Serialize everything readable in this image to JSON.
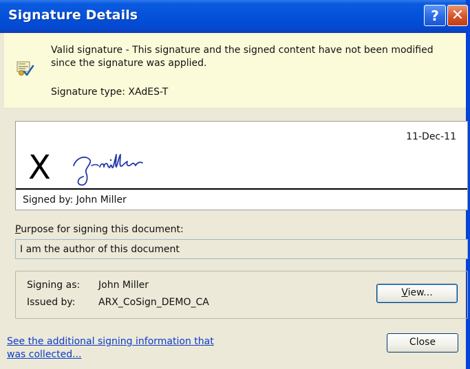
{
  "window": {
    "title": "Signature Details",
    "help_button": "?",
    "close_button": "✕"
  },
  "info": {
    "message": "Valid signature - This signature and the signed content have not been modified since the signature was applied.",
    "signature_type": "Signature type: XAdES-T"
  },
  "signature": {
    "date": "11-Dec-11",
    "x_mark": "X",
    "signed_by": "Signed by: John Miller"
  },
  "purpose": {
    "label_underlined": "P",
    "label_rest": "urpose for signing this document:",
    "value": "I am the author of this document"
  },
  "signer": {
    "signing_as_label": "Signing as:",
    "signing_as_value": "John Miller",
    "issued_by_label": "Issued by:",
    "issued_by_value": "ARX_CoSign_DEMO_CA"
  },
  "buttons": {
    "view_underlined": "V",
    "view_rest": "iew...",
    "close": "Close"
  },
  "link": {
    "text": "See the additional signing information that was collected..."
  },
  "colors": {
    "titlebar": "#0450d8",
    "info_background": "#fbfbd9",
    "dialog_background": "#ece9d8",
    "link": "#0a3cc8"
  },
  "icons": {
    "info": "certificate-check-icon",
    "help": "help-icon",
    "close": "close-icon"
  }
}
